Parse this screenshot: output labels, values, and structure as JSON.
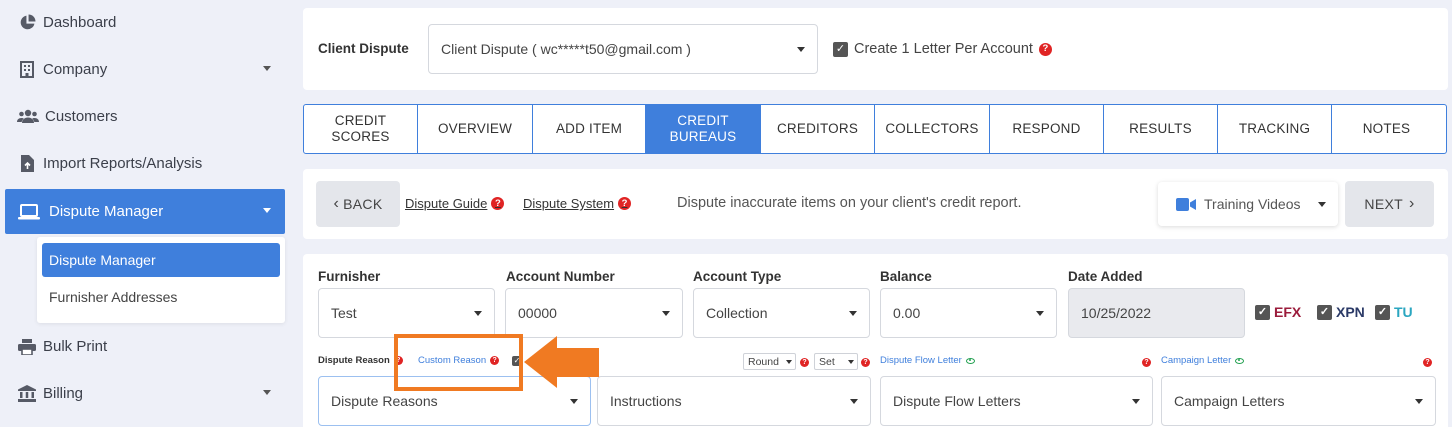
{
  "sidebar": {
    "items": [
      {
        "label": "Dashboard",
        "icon": "pie-chart-icon"
      },
      {
        "label": "Company",
        "icon": "building-icon"
      },
      {
        "label": "Customers",
        "icon": "users-icon"
      },
      {
        "label": "Import Reports/Analysis",
        "icon": "file-import-icon"
      },
      {
        "label": "Dispute Manager",
        "icon": "laptop-icon",
        "active": true
      },
      {
        "label": "Bulk Print",
        "icon": "printer-icon"
      },
      {
        "label": "Billing",
        "icon": "bank-icon"
      }
    ],
    "submenu": [
      {
        "label": "Dispute Manager",
        "active": true
      },
      {
        "label": "Furnisher Addresses"
      }
    ]
  },
  "top": {
    "client_dispute_label": "Client Dispute",
    "client_dispute_value": "Client Dispute ( wc*****t50@gmail.com )",
    "create_letter_label": "Create 1 Letter Per Account"
  },
  "tabs": [
    {
      "line1": "CREDIT",
      "line2": "SCORES"
    },
    {
      "line1": "OVERVIEW",
      "line2": ""
    },
    {
      "line1": "ADD ITEM",
      "line2": ""
    },
    {
      "line1": "CREDIT",
      "line2": "BUREAUS",
      "active": true
    },
    {
      "line1": "CREDITORS",
      "line2": ""
    },
    {
      "line1": "COLLECTORS",
      "line2": ""
    },
    {
      "line1": "RESPOND",
      "line2": ""
    },
    {
      "line1": "RESULTS",
      "line2": ""
    },
    {
      "line1": "TRACKING",
      "line2": ""
    },
    {
      "line1": "NOTES",
      "line2": ""
    }
  ],
  "action_bar": {
    "back_label": "BACK",
    "dispute_guide_label": "Dispute Guide",
    "dispute_system_label": "Dispute System",
    "description": "Dispute inaccurate items on your client's credit report.",
    "training_label": "Training Videos",
    "next_label": "NEXT"
  },
  "form": {
    "furnisher_label": "Furnisher",
    "furnisher_value": "Test",
    "account_number_label": "Account Number",
    "account_number_value": "00000",
    "account_type_label": "Account Type",
    "account_type_value": "Collection",
    "balance_label": "Balance",
    "balance_value": "0.00",
    "date_added_label": "Date Added",
    "date_added_value": "10/25/2022",
    "bureaus": [
      {
        "label": "EFX",
        "color": "#9b1c3c"
      },
      {
        "label": "XPN",
        "color": "#2b3a67"
      },
      {
        "label": "TU",
        "color": "#2aa6c0"
      }
    ],
    "dispute_reason_label": "Dispute Reason",
    "custom_reason_label": "Custom Reason",
    "round_value": "Round",
    "set_value": "Set",
    "dispute_flow_letter_label": "Dispute Flow Letter",
    "campaign_letter_label": "Campaign Letter",
    "dispute_reasons_placeholder": "Dispute Reasons",
    "instructions_placeholder": "Instructions",
    "dispute_flow_letters_placeholder": "Dispute Flow Letters",
    "campaign_letters_placeholder": "Campaign Letters"
  },
  "colors": {
    "accent": "#3f7fdc",
    "highlight": "#f07a22",
    "help": "#e02424"
  }
}
